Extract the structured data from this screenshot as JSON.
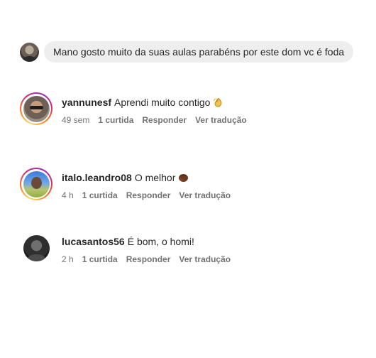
{
  "reply": {
    "text": "Mano gosto muito da suas aulas parabéns por este dom vc é foda"
  },
  "comments": [
    {
      "username": "yannunesf",
      "text": "Aprendi muito contigo",
      "emoji_icon": "clapping-hands-icon",
      "time": "49 sem",
      "likes": "1 curtida",
      "reply_label": "Responder",
      "translate_label": "Ver tradução"
    },
    {
      "username": "italo.leandro08",
      "text": "O melhor",
      "emoji_icon": "fist-icon",
      "time": "4 h",
      "likes": "1 curtida",
      "reply_label": "Responder",
      "translate_label": "Ver tradução"
    },
    {
      "username": "lucasantos56",
      "text": "É bom, o homi!",
      "time": "2 h",
      "likes": "1 curtida",
      "reply_label": "Responder",
      "translate_label": "Ver tradução"
    }
  ],
  "colors": {
    "story_ring": "#d62976",
    "meta_text": "#737373",
    "input_bg": "#eeeeee"
  }
}
